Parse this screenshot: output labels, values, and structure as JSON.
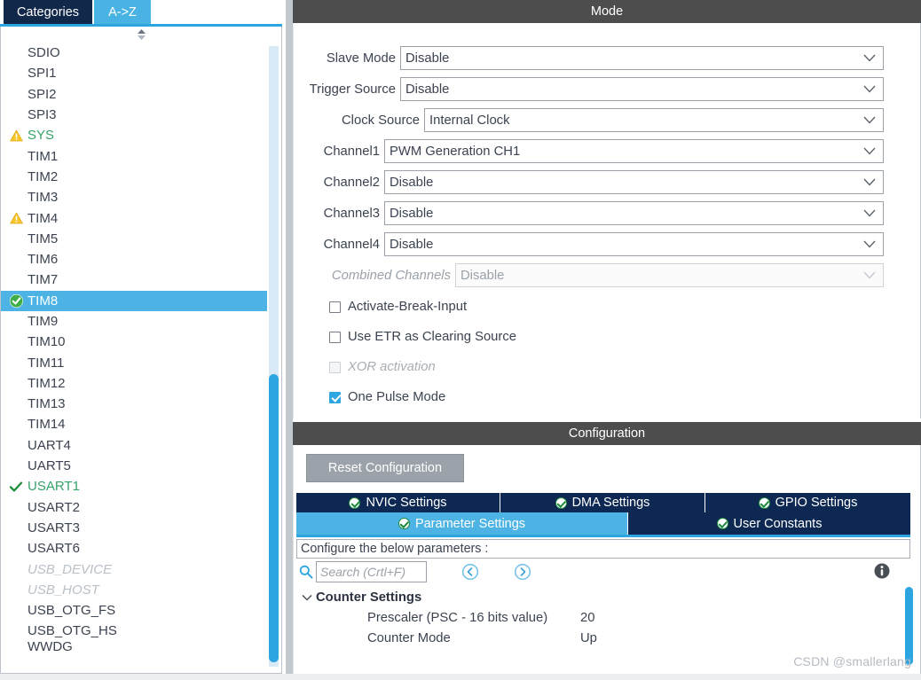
{
  "left_panel": {
    "tabs": [
      {
        "label": "Categories",
        "active": false
      },
      {
        "label": "A->Z",
        "active": true
      }
    ],
    "sort_icon": "sort-updown-icon",
    "peripherals": [
      {
        "label": "SDIO",
        "state": "normal",
        "icon": "none"
      },
      {
        "label": "SPI1",
        "state": "normal",
        "icon": "none"
      },
      {
        "label": "SPI2",
        "state": "normal",
        "icon": "none"
      },
      {
        "label": "SPI3",
        "state": "normal",
        "icon": "none"
      },
      {
        "label": "SYS",
        "state": "configured",
        "icon": "warning-triangle-icon"
      },
      {
        "label": "TIM1",
        "state": "normal",
        "icon": "none"
      },
      {
        "label": "TIM2",
        "state": "normal",
        "icon": "none"
      },
      {
        "label": "TIM3",
        "state": "normal",
        "icon": "none"
      },
      {
        "label": "TIM4",
        "state": "normal",
        "icon": "warning-triangle-icon"
      },
      {
        "label": "TIM5",
        "state": "normal",
        "icon": "none"
      },
      {
        "label": "TIM6",
        "state": "normal",
        "icon": "none"
      },
      {
        "label": "TIM7",
        "state": "normal",
        "icon": "none"
      },
      {
        "label": "TIM8",
        "state": "selected",
        "icon": "green-check-circle-icon"
      },
      {
        "label": "TIM9",
        "state": "normal",
        "icon": "none"
      },
      {
        "label": "TIM10",
        "state": "normal",
        "icon": "none"
      },
      {
        "label": "TIM11",
        "state": "normal",
        "icon": "none"
      },
      {
        "label": "TIM12",
        "state": "normal",
        "icon": "none"
      },
      {
        "label": "TIM13",
        "state": "normal",
        "icon": "none"
      },
      {
        "label": "TIM14",
        "state": "normal",
        "icon": "none"
      },
      {
        "label": "UART4",
        "state": "normal",
        "icon": "none"
      },
      {
        "label": "UART5",
        "state": "normal",
        "icon": "none"
      },
      {
        "label": "USART1",
        "state": "configured",
        "icon": "green-check-icon"
      },
      {
        "label": "USART2",
        "state": "normal",
        "icon": "none"
      },
      {
        "label": "USART3",
        "state": "normal",
        "icon": "none"
      },
      {
        "label": "USART6",
        "state": "normal",
        "icon": "none"
      },
      {
        "label": "USB_DEVICE",
        "state": "disabled",
        "icon": "none"
      },
      {
        "label": "USB_HOST",
        "state": "disabled",
        "icon": "none"
      },
      {
        "label": "USB_OTG_FS",
        "state": "normal",
        "icon": "none"
      },
      {
        "label": "USB_OTG_HS",
        "state": "normal",
        "icon": "none"
      },
      {
        "label": "WWDG",
        "state": "normal",
        "icon": "none"
      }
    ]
  },
  "mode": {
    "title": "Mode",
    "fields": [
      {
        "label": "Slave Mode",
        "value": "Disable",
        "enabled": true
      },
      {
        "label": "Trigger Source",
        "value": "Disable",
        "enabled": true
      },
      {
        "label": "Clock Source",
        "value": "Internal Clock",
        "enabled": true
      },
      {
        "label": "Channel1",
        "value": "PWM Generation CH1",
        "enabled": true
      },
      {
        "label": "Channel2",
        "value": "Disable",
        "enabled": true
      },
      {
        "label": "Channel3",
        "value": "Disable",
        "enabled": true
      },
      {
        "label": "Channel4",
        "value": "Disable",
        "enabled": true
      },
      {
        "label": "Combined Channels",
        "value": "Disable",
        "enabled": false
      }
    ],
    "checkboxes": [
      {
        "label": "Activate-Break-Input",
        "checked": false,
        "enabled": true
      },
      {
        "label": "Use ETR as Clearing Source",
        "checked": false,
        "enabled": true
      },
      {
        "label": "XOR activation",
        "checked": false,
        "enabled": false
      },
      {
        "label": "One Pulse Mode",
        "checked": true,
        "enabled": true
      }
    ]
  },
  "configuration": {
    "title": "Configuration",
    "reset_button": "Reset Configuration",
    "tabs_row1": [
      {
        "label": "NVIC Settings",
        "active": false
      },
      {
        "label": "DMA Settings",
        "active": false
      },
      {
        "label": "GPIO Settings",
        "active": false
      }
    ],
    "tabs_row2": [
      {
        "label": "Parameter Settings",
        "active": true
      },
      {
        "label": "User Constants",
        "active": false
      }
    ],
    "note": "Configure the below parameters :",
    "search": {
      "placeholder": "Search (Crtl+F)",
      "value": "",
      "icon": "magnifier-icon",
      "prev_icon": "circle-left-arrow-icon",
      "next_icon": "circle-right-arrow-icon"
    },
    "info_icon": "info-circle-icon",
    "tree": [
      {
        "group": "Counter Settings",
        "expanded": true,
        "items": [
          {
            "name": "Prescaler (PSC - 16 bits value)",
            "value": "20"
          },
          {
            "name": "Counter Mode",
            "value": "Up"
          }
        ]
      }
    ]
  },
  "watermark": "CSDN @smallerlang",
  "colors": {
    "accent_blue": "#2ca5e0",
    "tab_blue": "#4cb3e4",
    "navy": "#0d2853",
    "header_gray": "#4d4d4d",
    "green": "#38a169",
    "warning_yellow": "#f7c62c"
  }
}
